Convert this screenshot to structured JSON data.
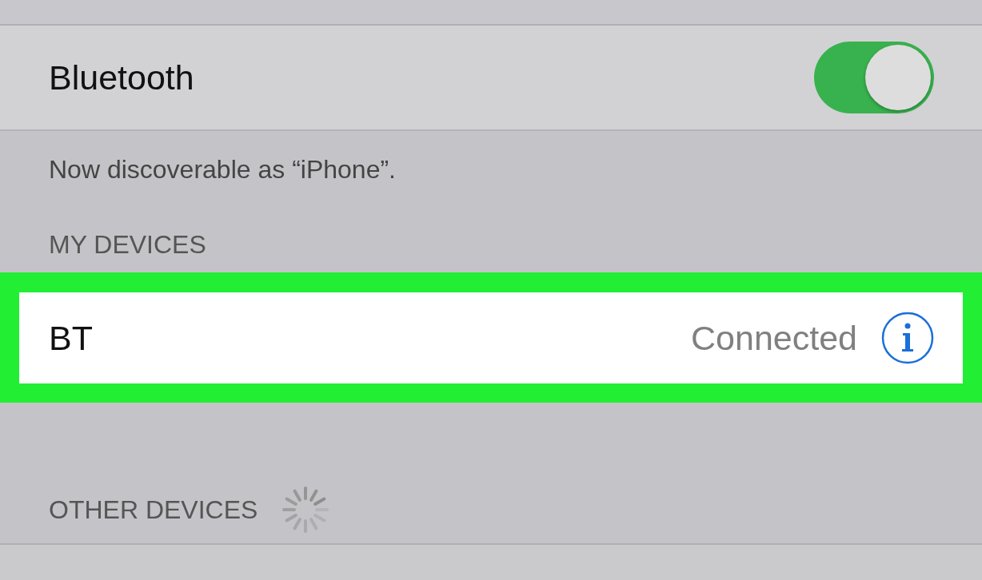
{
  "bluetooth": {
    "label": "Bluetooth",
    "on": true
  },
  "discoverable_note": "Now discoverable as “iPhone”.",
  "my_devices": {
    "header": "MY DEVICES",
    "devices": [
      {
        "name": "BT",
        "status": "Connected",
        "highlighted": true
      }
    ]
  },
  "other_devices": {
    "header": "OTHER DEVICES"
  }
}
